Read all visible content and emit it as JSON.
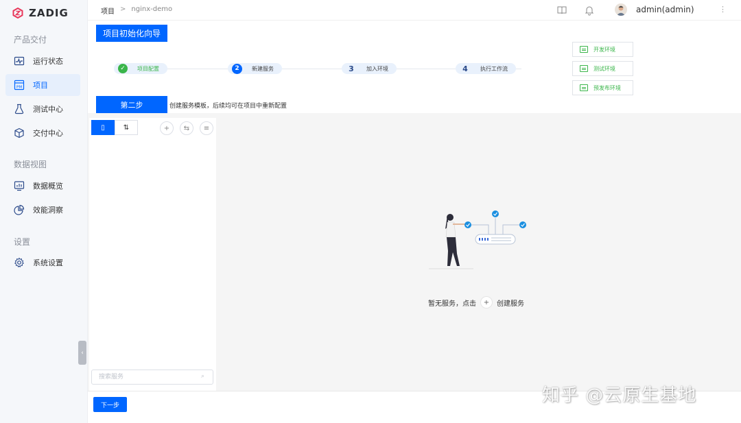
{
  "app": {
    "logo_text": "ZADIG"
  },
  "sidebar": {
    "groups": [
      {
        "label": "产品交付"
      },
      {
        "label": "数据视图"
      },
      {
        "label": "设置"
      }
    ],
    "items": [
      {
        "label": "运行状态",
        "icon": "pulse-icon"
      },
      {
        "label": "项目",
        "icon": "project-icon",
        "active": true
      },
      {
        "label": "测试中心",
        "icon": "flask-icon"
      },
      {
        "label": "交付中心",
        "icon": "package-icon"
      },
      {
        "label": "数据概览",
        "icon": "bar-chart-icon"
      },
      {
        "label": "效能洞察",
        "icon": "pie-chart-icon"
      },
      {
        "label": "系统设置",
        "icon": "gear-icon"
      }
    ],
    "collapse_glyph": "‹"
  },
  "topbar": {
    "breadcrumb_root": "项目",
    "breadcrumb_sep": ">",
    "breadcrumb_current": "nginx-demo",
    "username": "admin(admin)",
    "kebab": "⋮"
  },
  "guide_button": "项目初始化向导",
  "steps": [
    {
      "num": "✓",
      "label": "项目配置",
      "state": "done"
    },
    {
      "num": "2",
      "label": "新建服务",
      "state": "current"
    },
    {
      "num": "3",
      "label": "加入环境",
      "state": "todo"
    },
    {
      "num": "4",
      "label": "执行工作流",
      "state": "todo"
    }
  ],
  "env_cards": [
    {
      "label": "开发环境"
    },
    {
      "label": "测试环境"
    },
    {
      "label": "预发布环境"
    }
  ],
  "step_tag": "第二步",
  "step_desc": "创建服务模板，后续均可在项目中重新配置",
  "panel": {
    "seg_on": "▯",
    "seg_off": "⇅",
    "btn_add": "+",
    "btn_tree": "⇆",
    "btn_list": "≡",
    "search_placeholder": "搜索服务",
    "search_icon": "⌕"
  },
  "empty": {
    "text_before": "暂无服务，点击",
    "plus": "+",
    "text_after": "创建服务"
  },
  "next_button": "下一步",
  "watermark": "知乎 @云原生基地",
  "colors": {
    "accent": "#0066ff",
    "success": "#3ab54a",
    "logo": "#e8375a"
  }
}
